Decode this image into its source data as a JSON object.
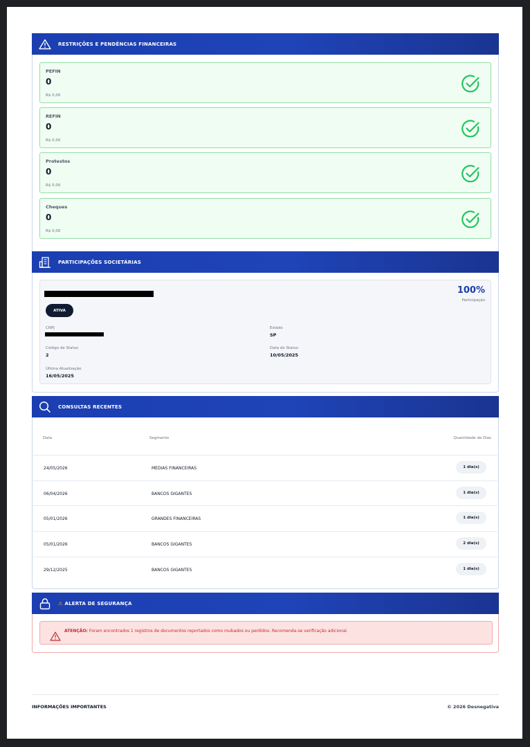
{
  "restricoes": {
    "title": "RESTRIÇÕES E PENDÊNCIAS FINANCEIRAS",
    "items": [
      {
        "label": "PEFIN",
        "count": "0",
        "amount": "R$ 0,00"
      },
      {
        "label": "REFIN",
        "count": "0",
        "amount": "R$ 0,00"
      },
      {
        "label": "Protestos",
        "count": "0",
        "amount": "R$ 0,00"
      },
      {
        "label": "Cheques",
        "count": "0",
        "amount": "R$ 0,00"
      }
    ]
  },
  "participacoes": {
    "title": "PARTICIPAÇÕES SOCIETÁRIAS",
    "status_badge": "ATIVA",
    "percent": "100%",
    "percent_label": "Participação",
    "cnpj_label": "CNPJ",
    "estado_label": "Estado",
    "estado_value": "SP",
    "codigo_label": "Código de Status",
    "codigo_value": "2",
    "data_status_label": "Data do Status",
    "data_status_value": "10/05/2025",
    "atualizacao_label": "Última Atualização",
    "atualizacao_value": "16/05/2025"
  },
  "consultas": {
    "title": "CONSULTAS RECENTES",
    "headers": [
      "Data",
      "Segmento",
      "Quantidade de Dias"
    ],
    "rows": [
      {
        "data": "24/05/2026",
        "segmento": "MEDIAS FINANCEIRAS",
        "dias": "1 dia(s)"
      },
      {
        "data": "06/04/2026",
        "segmento": "BANCOS GIGANTES",
        "dias": "1 dia(s)"
      },
      {
        "data": "05/01/2026",
        "segmento": "GRANDES FINANCEIRAS",
        "dias": "1 dia(s)"
      },
      {
        "data": "05/01/2026",
        "segmento": "BANCOS GIGANTES",
        "dias": "2 dia(s)"
      },
      {
        "data": "29/12/2025",
        "segmento": "BANCOS GIGANTES",
        "dias": "1 dia(s)"
      }
    ]
  },
  "alerta": {
    "title_icon": "⚠",
    "title": "ALERTA DE SEGURANÇA",
    "prefix": "ATENÇÃO:",
    "message": " Foram encontrados 1 registros de documentos reportados como roubados ou perdidos. Recomenda-se verificação adicional."
  },
  "footer": {
    "left": "INFORMAÇÕES IMPORTANTES",
    "right": "© 2026 Desnegativa"
  },
  "colors": {
    "header_blue": "#1f44b8",
    "success_green": "#22c55e",
    "alert_red": "#c22a2a"
  },
  "icons": [
    "warning-triangle-icon",
    "check-circle-icon",
    "building-icon",
    "search-icon",
    "lock-icon"
  ]
}
